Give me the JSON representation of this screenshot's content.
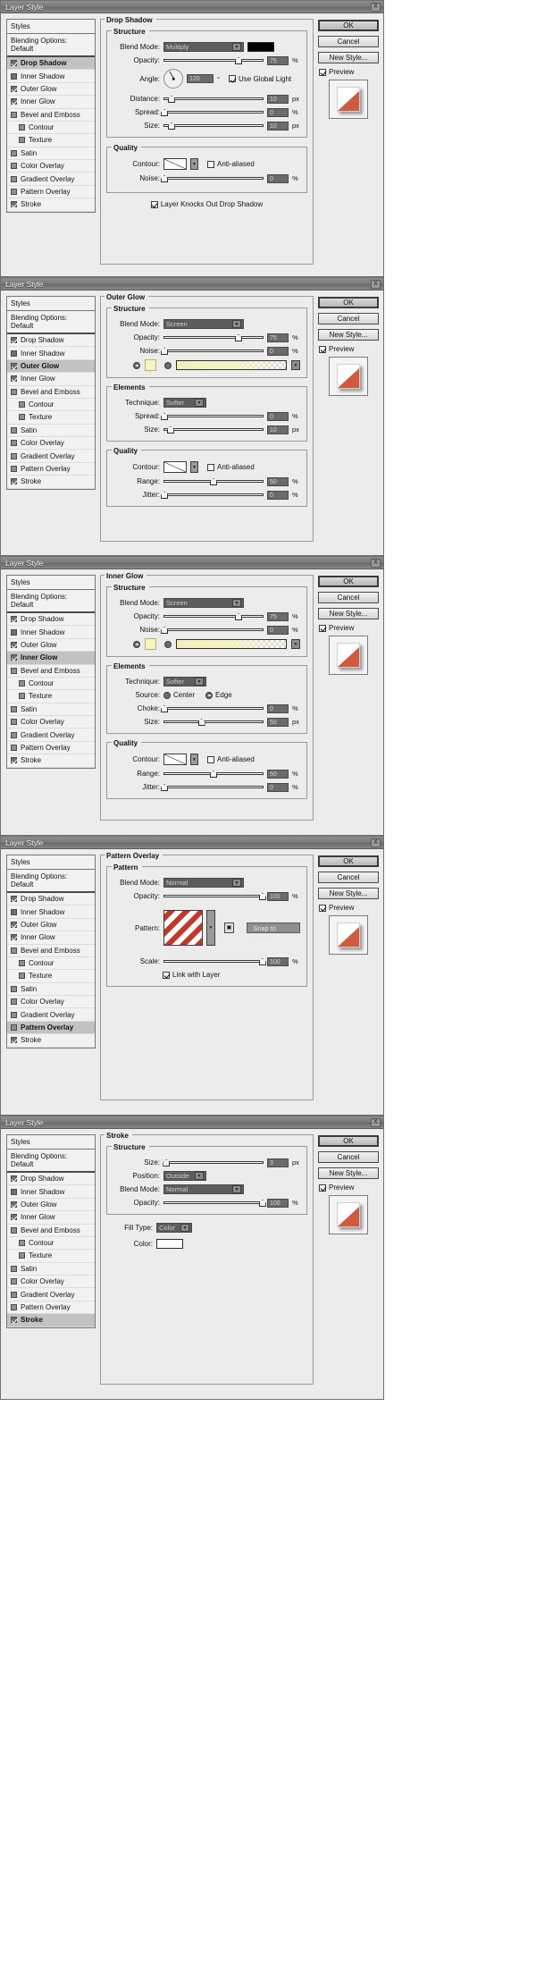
{
  "window": {
    "title": "Layer Style",
    "close_label": "X"
  },
  "styles_panel": {
    "styles_label": "Styles",
    "blending_label": "Blending Options: Default",
    "items": [
      {
        "label": "Drop Shadow",
        "checked": true,
        "indent": false
      },
      {
        "label": "Inner Shadow",
        "checked": false,
        "indent": false
      },
      {
        "label": "Outer Glow",
        "checked": true,
        "indent": false
      },
      {
        "label": "Inner Glow",
        "checked": true,
        "indent": false
      },
      {
        "label": "Bevel and Emboss",
        "checked": false,
        "indent": false
      },
      {
        "label": "Contour",
        "checked": false,
        "indent": true
      },
      {
        "label": "Texture",
        "checked": false,
        "indent": true
      },
      {
        "label": "Satin",
        "checked": false,
        "indent": false
      },
      {
        "label": "Color Overlay",
        "checked": false,
        "indent": false
      },
      {
        "label": "Gradient Overlay",
        "checked": false,
        "indent": false
      },
      {
        "label": "Pattern Overlay",
        "checked": false,
        "indent": false
      },
      {
        "label": "Stroke",
        "checked": true,
        "indent": false
      }
    ]
  },
  "buttons": {
    "ok": "OK",
    "cancel": "Cancel",
    "new_style": "New Style...",
    "preview": "Preview"
  },
  "labels": {
    "structure": "Structure",
    "quality": "Quality",
    "elements": "Elements",
    "pattern": "Pattern",
    "blend_mode": "Blend Mode:",
    "opacity": "Opacity:",
    "angle": "Angle:",
    "distance": "Distance:",
    "spread": "Spread:",
    "size": "Size:",
    "contour": "Contour:",
    "noise": "Noise:",
    "technique": "Technique:",
    "range": "Range:",
    "jitter": "Jitter:",
    "source": "Source:",
    "choke": "Choke:",
    "scale": "Scale:",
    "position": "Position:",
    "fill_type": "Fill Type:",
    "color": "Color:",
    "anti_aliased": "Anti-aliased",
    "use_global_light": "Use Global Light",
    "layer_knocks_out": "Layer Knocks Out Drop Shadow",
    "link_with_layer": "Link with Layer",
    "snap_to_origin": "Snap to Origin",
    "center": "Center",
    "edge": "Edge",
    "pct": "%",
    "px": "px",
    "deg": "°"
  },
  "panels": [
    {
      "id": "drop-shadow",
      "title": "Drop Shadow",
      "selected_style": "Drop Shadow",
      "blend_mode": "Multiply",
      "blend_color": "#000000",
      "opacity": "75",
      "angle": "120",
      "use_global_light": true,
      "distance": "10",
      "spread": "0",
      "size": "10",
      "anti_aliased": false,
      "noise": "0",
      "knocks_out": true
    },
    {
      "id": "outer-glow",
      "title": "Outer Glow",
      "selected_style": "Outer Glow",
      "blend_mode": "Screen",
      "opacity": "75",
      "noise": "0",
      "glow_color": "#f8f3c0",
      "technique": "Softer",
      "spread": "0",
      "size": "10",
      "anti_aliased": false,
      "range": "50",
      "jitter": "0"
    },
    {
      "id": "inner-glow",
      "title": "Inner Glow",
      "selected_style": "Inner Glow",
      "blend_mode": "Screen",
      "opacity": "75",
      "noise": "0",
      "glow_color": "#f8f3c0",
      "technique": "Softer",
      "source_center": false,
      "source_edge": true,
      "choke": "0",
      "size": "50",
      "anti_aliased": false,
      "range": "50",
      "jitter": "0"
    },
    {
      "id": "pattern-overlay",
      "title": "Pattern Overlay",
      "selected_style": "Pattern Overlay",
      "blend_mode": "Normal",
      "opacity": "100",
      "scale": "100",
      "link_with_layer": true
    },
    {
      "id": "stroke",
      "title": "Stroke",
      "selected_style": "Stroke",
      "size": "3",
      "position": "Outside",
      "blend_mode": "Normal",
      "opacity": "100",
      "fill_type": "Color",
      "color": "#ffffff"
    }
  ]
}
